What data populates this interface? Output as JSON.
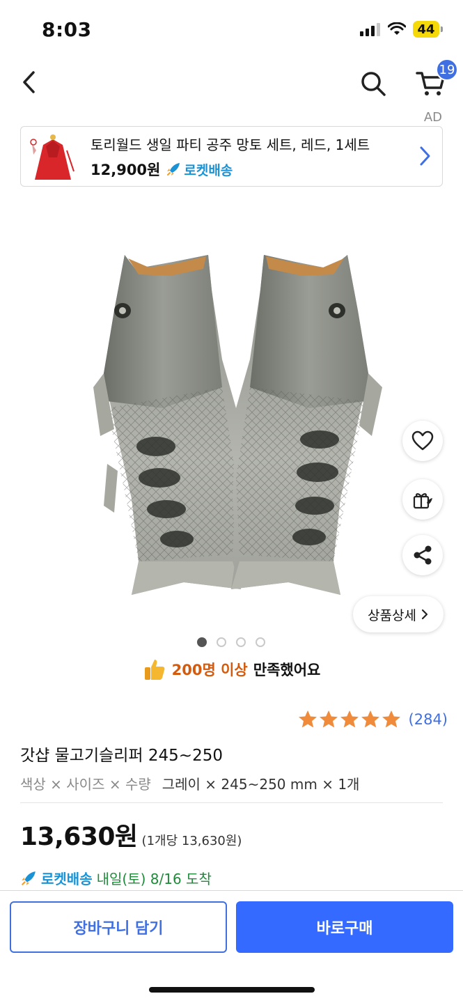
{
  "status_bar": {
    "time": "8:03",
    "battery": "44"
  },
  "header": {
    "cart_count": "19"
  },
  "ad": {
    "label": "AD",
    "title": "토리월드 생일 파티 공주 망토 세트, 레드, 1세트",
    "price": "12,900원",
    "rocket_label": "로켓배송"
  },
  "gallery": {
    "detail_label": "상품상세",
    "page_count": 4,
    "active_index": 0
  },
  "satisfaction": {
    "highlight": "200명 이상",
    "rest": "만족했어요"
  },
  "rating": {
    "stars": 5,
    "count": "(284)"
  },
  "product": {
    "title": "갓샵 물고기슬리퍼 245~250",
    "option_label": "색상 × 사이즈 × 수량",
    "option_values": "그레이 × 245~250 mm × 1개",
    "price": "13,630원",
    "unit_price": "(1개당 13,630원)"
  },
  "delivery": {
    "rocket_label": "로켓배송",
    "text": "내일(토) 8/16 도착"
  },
  "actions": {
    "cart_label": "장바구니 담기",
    "buy_label": "바로구매"
  },
  "colors": {
    "accent": "#346aff",
    "rocket": "#1a93d6",
    "star": "#f08b3c",
    "satisfaction": "#d35b0f",
    "delivery": "#1f8a3a"
  }
}
